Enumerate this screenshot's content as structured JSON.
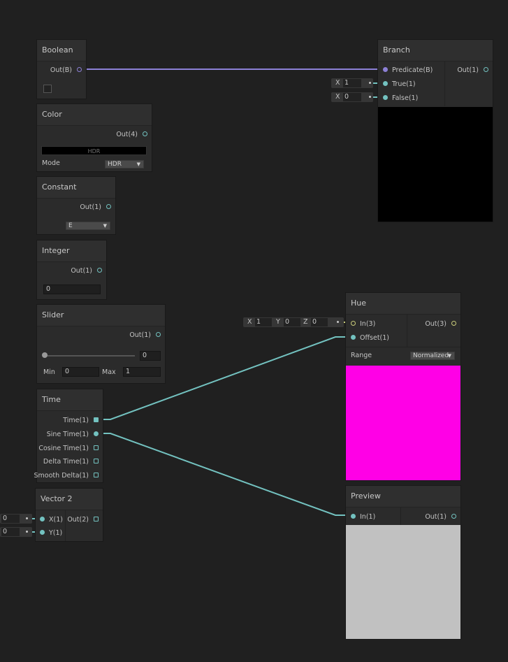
{
  "nodes": {
    "boolean": {
      "title": "Boolean",
      "out": "Out(B)"
    },
    "branch": {
      "title": "Branch",
      "predicate": "Predicate(B)",
      "true_in": "True(1)",
      "false_in": "False(1)",
      "out": "Out(1)",
      "true_x_label": "X",
      "true_x_value": "1",
      "false_x_label": "X",
      "false_x_value": "0"
    },
    "color": {
      "title": "Color",
      "out": "Out(4)",
      "swatch_text": "HDR",
      "mode_label": "Mode",
      "mode_value": "HDR"
    },
    "constant": {
      "title": "Constant",
      "out": "Out(1)",
      "value": "E"
    },
    "integer": {
      "title": "Integer",
      "out": "Out(1)",
      "value": "0"
    },
    "slider": {
      "title": "Slider",
      "out": "Out(1)",
      "value": "0",
      "min_label": "Min",
      "min_value": "0",
      "max_label": "Max",
      "max_value": "1",
      "level": 0
    },
    "time": {
      "title": "Time",
      "outputs": [
        "Time(1)",
        "Sine Time(1)",
        "Cosine Time(1)",
        "Delta Time(1)",
        "Smooth Delta(1)"
      ]
    },
    "vector2": {
      "title": "Vector 2",
      "x_in": "X(1)",
      "y_in": "Y(1)",
      "out": "Out(2)",
      "x_value": "0",
      "y_value": "0"
    },
    "hue": {
      "title": "Hue",
      "in": "In(3)",
      "offset": "Offset(1)",
      "out": "Out(3)",
      "range_label": "Range",
      "range_value": "Normalized",
      "x_label": "X",
      "x_value": "1",
      "y_label": "Y",
      "y_value": "0",
      "z_label": "Z",
      "z_value": "0"
    },
    "preview": {
      "title": "Preview",
      "in": "In(1)",
      "out": "Out(1)"
    }
  },
  "colors": {
    "background": "#202020",
    "bool_wire": "#8c80d6",
    "float_wire": "#73c2c0",
    "hue_preview": "#ff00e6",
    "branch_preview": "#000000",
    "preview_preview": "#c1c1c1"
  }
}
